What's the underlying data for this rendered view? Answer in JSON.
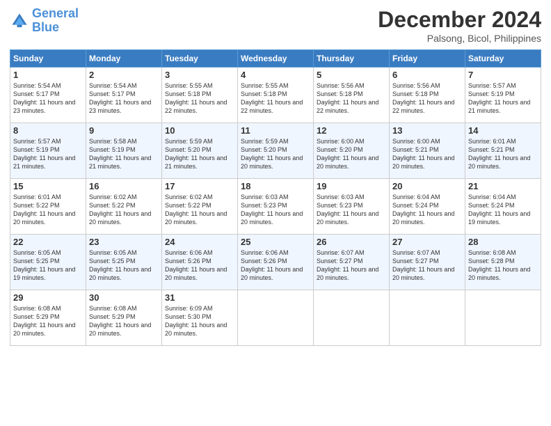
{
  "logo": {
    "line1": "General",
    "line2": "Blue"
  },
  "title": "December 2024",
  "subtitle": "Palsong, Bicol, Philippines",
  "days_header": [
    "Sunday",
    "Monday",
    "Tuesday",
    "Wednesday",
    "Thursday",
    "Friday",
    "Saturday"
  ],
  "weeks": [
    [
      {
        "day": "1",
        "sunrise": "Sunrise: 5:54 AM",
        "sunset": "Sunset: 5:17 PM",
        "daylight": "Daylight: 11 hours and 23 minutes."
      },
      {
        "day": "2",
        "sunrise": "Sunrise: 5:54 AM",
        "sunset": "Sunset: 5:17 PM",
        "daylight": "Daylight: 11 hours and 23 minutes."
      },
      {
        "day": "3",
        "sunrise": "Sunrise: 5:55 AM",
        "sunset": "Sunset: 5:18 PM",
        "daylight": "Daylight: 11 hours and 22 minutes."
      },
      {
        "day": "4",
        "sunrise": "Sunrise: 5:55 AM",
        "sunset": "Sunset: 5:18 PM",
        "daylight": "Daylight: 11 hours and 22 minutes."
      },
      {
        "day": "5",
        "sunrise": "Sunrise: 5:56 AM",
        "sunset": "Sunset: 5:18 PM",
        "daylight": "Daylight: 11 hours and 22 minutes."
      },
      {
        "day": "6",
        "sunrise": "Sunrise: 5:56 AM",
        "sunset": "Sunset: 5:18 PM",
        "daylight": "Daylight: 11 hours and 22 minutes."
      },
      {
        "day": "7",
        "sunrise": "Sunrise: 5:57 AM",
        "sunset": "Sunset: 5:19 PM",
        "daylight": "Daylight: 11 hours and 21 minutes."
      }
    ],
    [
      {
        "day": "8",
        "sunrise": "Sunrise: 5:57 AM",
        "sunset": "Sunset: 5:19 PM",
        "daylight": "Daylight: 11 hours and 21 minutes."
      },
      {
        "day": "9",
        "sunrise": "Sunrise: 5:58 AM",
        "sunset": "Sunset: 5:19 PM",
        "daylight": "Daylight: 11 hours and 21 minutes."
      },
      {
        "day": "10",
        "sunrise": "Sunrise: 5:59 AM",
        "sunset": "Sunset: 5:20 PM",
        "daylight": "Daylight: 11 hours and 21 minutes."
      },
      {
        "day": "11",
        "sunrise": "Sunrise: 5:59 AM",
        "sunset": "Sunset: 5:20 PM",
        "daylight": "Daylight: 11 hours and 20 minutes."
      },
      {
        "day": "12",
        "sunrise": "Sunrise: 6:00 AM",
        "sunset": "Sunset: 5:20 PM",
        "daylight": "Daylight: 11 hours and 20 minutes."
      },
      {
        "day": "13",
        "sunrise": "Sunrise: 6:00 AM",
        "sunset": "Sunset: 5:21 PM",
        "daylight": "Daylight: 11 hours and 20 minutes."
      },
      {
        "day": "14",
        "sunrise": "Sunrise: 6:01 AM",
        "sunset": "Sunset: 5:21 PM",
        "daylight": "Daylight: 11 hours and 20 minutes."
      }
    ],
    [
      {
        "day": "15",
        "sunrise": "Sunrise: 6:01 AM",
        "sunset": "Sunset: 5:22 PM",
        "daylight": "Daylight: 11 hours and 20 minutes."
      },
      {
        "day": "16",
        "sunrise": "Sunrise: 6:02 AM",
        "sunset": "Sunset: 5:22 PM",
        "daylight": "Daylight: 11 hours and 20 minutes."
      },
      {
        "day": "17",
        "sunrise": "Sunrise: 6:02 AM",
        "sunset": "Sunset: 5:22 PM",
        "daylight": "Daylight: 11 hours and 20 minutes."
      },
      {
        "day": "18",
        "sunrise": "Sunrise: 6:03 AM",
        "sunset": "Sunset: 5:23 PM",
        "daylight": "Daylight: 11 hours and 20 minutes."
      },
      {
        "day": "19",
        "sunrise": "Sunrise: 6:03 AM",
        "sunset": "Sunset: 5:23 PM",
        "daylight": "Daylight: 11 hours and 20 minutes."
      },
      {
        "day": "20",
        "sunrise": "Sunrise: 6:04 AM",
        "sunset": "Sunset: 5:24 PM",
        "daylight": "Daylight: 11 hours and 20 minutes."
      },
      {
        "day": "21",
        "sunrise": "Sunrise: 6:04 AM",
        "sunset": "Sunset: 5:24 PM",
        "daylight": "Daylight: 11 hours and 19 minutes."
      }
    ],
    [
      {
        "day": "22",
        "sunrise": "Sunrise: 6:05 AM",
        "sunset": "Sunset: 5:25 PM",
        "daylight": "Daylight: 11 hours and 19 minutes."
      },
      {
        "day": "23",
        "sunrise": "Sunrise: 6:05 AM",
        "sunset": "Sunset: 5:25 PM",
        "daylight": "Daylight: 11 hours and 20 minutes."
      },
      {
        "day": "24",
        "sunrise": "Sunrise: 6:06 AM",
        "sunset": "Sunset: 5:26 PM",
        "daylight": "Daylight: 11 hours and 20 minutes."
      },
      {
        "day": "25",
        "sunrise": "Sunrise: 6:06 AM",
        "sunset": "Sunset: 5:26 PM",
        "daylight": "Daylight: 11 hours and 20 minutes."
      },
      {
        "day": "26",
        "sunrise": "Sunrise: 6:07 AM",
        "sunset": "Sunset: 5:27 PM",
        "daylight": "Daylight: 11 hours and 20 minutes."
      },
      {
        "day": "27",
        "sunrise": "Sunrise: 6:07 AM",
        "sunset": "Sunset: 5:27 PM",
        "daylight": "Daylight: 11 hours and 20 minutes."
      },
      {
        "day": "28",
        "sunrise": "Sunrise: 6:08 AM",
        "sunset": "Sunset: 5:28 PM",
        "daylight": "Daylight: 11 hours and 20 minutes."
      }
    ],
    [
      {
        "day": "29",
        "sunrise": "Sunrise: 6:08 AM",
        "sunset": "Sunset: 5:29 PM",
        "daylight": "Daylight: 11 hours and 20 minutes."
      },
      {
        "day": "30",
        "sunrise": "Sunrise: 6:08 AM",
        "sunset": "Sunset: 5:29 PM",
        "daylight": "Daylight: 11 hours and 20 minutes."
      },
      {
        "day": "31",
        "sunrise": "Sunrise: 6:09 AM",
        "sunset": "Sunset: 5:30 PM",
        "daylight": "Daylight: 11 hours and 20 minutes."
      },
      null,
      null,
      null,
      null
    ]
  ]
}
